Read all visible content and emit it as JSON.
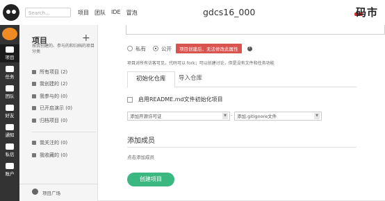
{
  "topbar": {
    "search_placeholder": "Search...",
    "nav": [
      "项目",
      "团队",
      "IDE",
      "冒泡"
    ],
    "project_name": "gdcs16_000",
    "brand_text": "码市"
  },
  "leftbar": {
    "items": [
      "项目",
      "任务",
      "团队",
      "好友",
      "通知",
      "私信",
      "账户"
    ]
  },
  "sidebar": {
    "title": "项目",
    "plus": "+",
    "description": "按我创建的、参与的和归档的项目分类",
    "items": [
      "所有项目 (2)",
      "我创建的 (2)",
      "我参与的 (0)",
      "已开启演示 (0)",
      "归档项目 (0)",
      "我关注的 (0)",
      "我收藏的 (0)"
    ],
    "footer": "项目广场"
  },
  "form": {
    "private_label": "私有",
    "public_label": "公开",
    "public_warning": "项目创建后，无法修改此属性",
    "help_icon": "?",
    "visibility_hint": "项目对所有访客可见，代码可以 fork；可以创建讨论，但是没有文件和任务功能",
    "tabs": [
      "初始化仓库",
      "导入仓库"
    ],
    "readme_label": "启用README.md文件初始化项目",
    "license_select": "添加开源许可证",
    "gitignore_select": "添加.gitignore文件",
    "select_separator": "-",
    "add_member_title": "添加成员",
    "add_member_hint": "点击添加成员",
    "create_button": "创建项目"
  },
  "colors": {
    "accent_green": "#3bb87f",
    "warning_red": "#d9534f",
    "dark_nav": "#333333"
  }
}
